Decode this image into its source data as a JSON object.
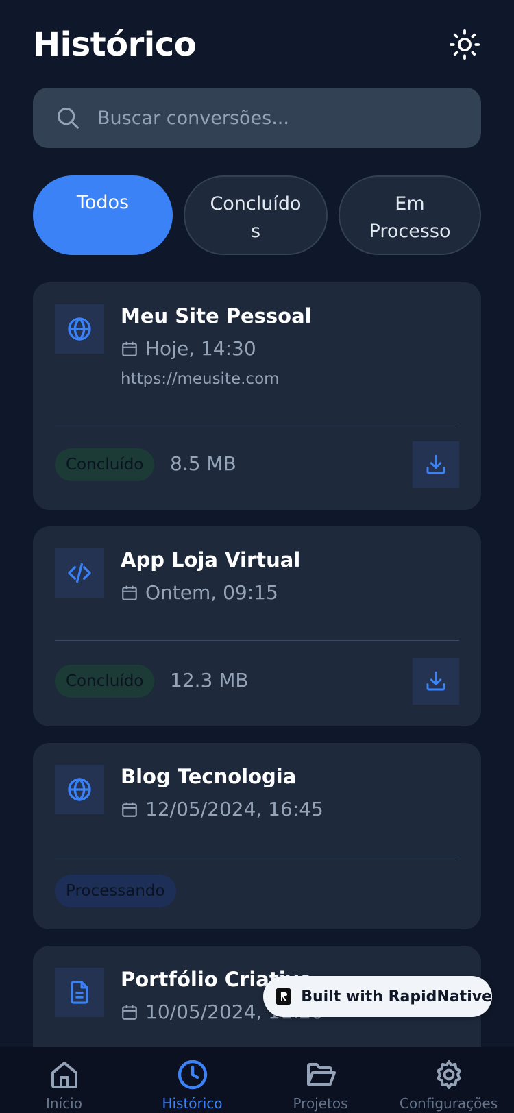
{
  "header": {
    "title": "Histórico",
    "theme_icon": "sun-icon"
  },
  "search": {
    "placeholder": "Buscar conversões..."
  },
  "filters": [
    {
      "label": "Todos",
      "active": true
    },
    {
      "label": "Concluído\ns",
      "active": false
    },
    {
      "label": "Em\nProcesso",
      "active": false
    }
  ],
  "cards": [
    {
      "title": "Meu Site Pessoal",
      "date": "Hoje, 14:30",
      "url": "https://meusite.com",
      "status": "Concluído",
      "size": "8.5 MB",
      "icon": "globe-icon"
    },
    {
      "title": "App Loja Virtual",
      "date": "Ontem, 09:15",
      "status": "Concluído",
      "size": "12.3 MB",
      "icon": "code-icon"
    },
    {
      "title": "Blog Tecnologia",
      "date": "12/05/2024, 16:45",
      "status": "Processando",
      "icon": "globe-icon"
    },
    {
      "title": "Portfólio Criativo",
      "date": "10/05/2024, 11:20",
      "icon": "document-icon"
    }
  ],
  "tabbar": [
    {
      "label": "Início",
      "icon": "home-icon",
      "active": false
    },
    {
      "label": "Histórico",
      "icon": "clock-icon",
      "active": true
    },
    {
      "label": "Projetos",
      "icon": "folder-icon",
      "active": false
    },
    {
      "label": "Configurações",
      "icon": "gear-icon",
      "active": false
    }
  ],
  "badge": {
    "text": "Built with RapidNative"
  },
  "colors": {
    "background": "#0f172a",
    "card": "#1e293b",
    "accent": "#3b82f6",
    "muted": "#94a3b8"
  }
}
